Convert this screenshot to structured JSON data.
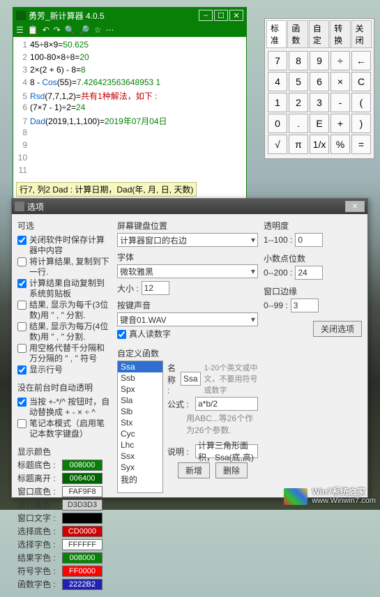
{
  "calc": {
    "title": "勇芳_新计算器 4.0.5",
    "toolbar": [
      "☰",
      "📋",
      "↶",
      "↷",
      "🔍",
      "🔎",
      "☆",
      "⋯"
    ],
    "titlectl": [
      "–",
      "☐",
      "✕"
    ],
    "lines": [
      {
        "n": "1",
        "segs": [
          {
            "t": "45÷8×9=",
            "c": "black"
          },
          {
            "t": "50.625",
            "c": "green"
          }
        ]
      },
      {
        "n": "2",
        "segs": [
          {
            "t": "100-80×8÷8=",
            "c": "black"
          },
          {
            "t": "20",
            "c": "green"
          }
        ]
      },
      {
        "n": "3",
        "segs": [
          {
            "t": "2×(2 + 6) - 8=",
            "c": "black"
          },
          {
            "t": "8",
            "c": "green"
          }
        ]
      },
      {
        "n": "4",
        "segs": [
          {
            "t": "8 - ",
            "c": "black"
          },
          {
            "t": "Cos",
            "c": "blue"
          },
          {
            "t": "(55)=",
            "c": "black"
          },
          {
            "t": "7.426423563648953 1",
            "c": "green"
          }
        ]
      },
      {
        "n": "5",
        "segs": [
          {
            "t": "Rsd",
            "c": "blue"
          },
          {
            "t": "(7,7,1,2)=",
            "c": "black"
          },
          {
            "t": "共有1种解法，如下 :",
            "c": "red"
          }
        ]
      },
      {
        "n": "6",
        "segs": [
          {
            "t": "(7×7 - 1)÷2=",
            "c": "black"
          },
          {
            "t": "24",
            "c": "green"
          }
        ]
      },
      {
        "n": "7",
        "segs": [
          {
            "t": "D",
            "c": "blue"
          },
          {
            "t": "a",
            "c": "blue"
          },
          {
            "t": "d",
            "c": "blue"
          },
          {
            "t": "(2019,1,1,100)=",
            "c": "black"
          },
          {
            "t": "2019年07月04日",
            "c": "green"
          }
        ]
      },
      {
        "n": "8",
        "segs": []
      },
      {
        "n": "9",
        "segs": []
      },
      {
        "n": "10",
        "segs": []
      },
      {
        "n": "11",
        "segs": []
      }
    ],
    "status": "行7, 列2    Dad : 计算日期，Dad(年, 月, 日, 天数)"
  },
  "keypad": {
    "tabs": [
      "标准",
      "函数",
      "自定",
      "转换",
      "关闭"
    ],
    "buttons": [
      "7",
      "8",
      "9",
      "÷",
      "←",
      "4",
      "5",
      "6",
      "×",
      "C",
      "1",
      "2",
      "3",
      "-",
      "(",
      "0",
      ".",
      "E",
      "+",
      ")",
      "√",
      "π",
      "1/x",
      "%",
      "="
    ]
  },
  "options": {
    "title": "选项",
    "close": "✕",
    "sec_optional": "可选",
    "chks": [
      {
        "c": true,
        "t": "关闭软件时保存计算器中内容"
      },
      {
        "c": false,
        "t": "将计算结果, 复制到下一行."
      },
      {
        "c": true,
        "t": "计算结果自动复制到系统剪贴板"
      },
      {
        "c": false,
        "t": "结果, 显示为每千(3位数)用 \" , \" 分割."
      },
      {
        "c": false,
        "t": "结果, 显示为每万(4位数)用 \" , \" 分割."
      },
      {
        "c": false,
        "t": "用空格代替千分隔和万分隔的 \" , \" 符号"
      },
      {
        "c": true,
        "t": "显示行号"
      }
    ],
    "sec_bg": "没在前台时自动透明",
    "chks2": [
      {
        "c": true,
        "t": "当按 +-*/^ 按钮时，自动替换成 + - × ÷ ^"
      },
      {
        "c": false,
        "t": "笔记本模式（启用笔记本数字键盘）"
      }
    ],
    "sec_colors": "显示颜色",
    "colors": [
      {
        "l": "标题底色 :",
        "v": "008000",
        "bg": "#088008",
        "fg": "#fff"
      },
      {
        "l": "标题离开 :",
        "v": "006400",
        "bg": "#006400",
        "fg": "#fff"
      },
      {
        "l": "窗口底色 :",
        "v": "FAF9F8",
        "bg": "#FAF9F8",
        "fg": "#333"
      },
      {
        "l": "运行底色 :",
        "v": "D3D3D3",
        "bg": "#D3D3D3",
        "fg": "#333"
      },
      {
        "l": "窗口文字 :",
        "v": "",
        "bg": "#000",
        "fg": "#fff"
      },
      {
        "l": "选择底色 :",
        "v": "CD0000",
        "bg": "#CD0000",
        "fg": "#fff"
      },
      {
        "l": "选择字色 :",
        "v": "FFFFFF",
        "bg": "#FFFFFF",
        "fg": "#333"
      },
      {
        "l": "结果字色 :",
        "v": "008000",
        "bg": "#088008",
        "fg": "#fff"
      },
      {
        "l": "符号字色 :",
        "v": "FF0000",
        "bg": "#FF0000",
        "fg": "#fff"
      },
      {
        "l": "函数字色 :",
        "v": "2222B2",
        "bg": "#2222B2",
        "fg": "#fff"
      }
    ],
    "sec_kbpos": "屏幕键盘位置",
    "kbpos": "计算器窗口的右边",
    "sec_font": "字体",
    "font": "微软雅黑",
    "font_size_lbl": "大小 :",
    "font_size": "12",
    "sec_sound": "按键声音",
    "sound": "键音01.WAV",
    "chk_voice": {
      "c": true,
      "t": "真人读数字"
    },
    "sec_trans": "透明度",
    "trans_lbl": "1--100 :",
    "trans": "0",
    "sec_dec": "小数点位数",
    "dec_lbl": "0--200 :",
    "dec": "24",
    "sec_pad": "窗口边缘",
    "pad_lbl": "0--99 :",
    "pad": "3",
    "btn_close_opt": "关闭选项",
    "sec_custom": "自定义函数",
    "list": [
      "Ssa",
      "Ssb",
      "Spx",
      "Sla",
      "Slb",
      "Stx",
      "Cyc",
      "Lhc",
      "Ssx",
      "Syx",
      "我的"
    ],
    "f_name_lbl": "名称 :",
    "f_name": "Ssa",
    "f_name_hint": "1-20个英文或中文，不要用符号或数字",
    "f_formula_lbl": "公式 :",
    "f_formula": "a*b/2",
    "f_formula_hint": "用ABC...等26个作为26个参数.",
    "f_desc_lbl": "说明 :",
    "f_desc": "计算三角形面积，Ssa(底,高)",
    "btn_new": "新增",
    "btn_del": "删除"
  },
  "watermark": {
    "brand": "Win7系统之家",
    "url": "www.Winwin7.com"
  }
}
